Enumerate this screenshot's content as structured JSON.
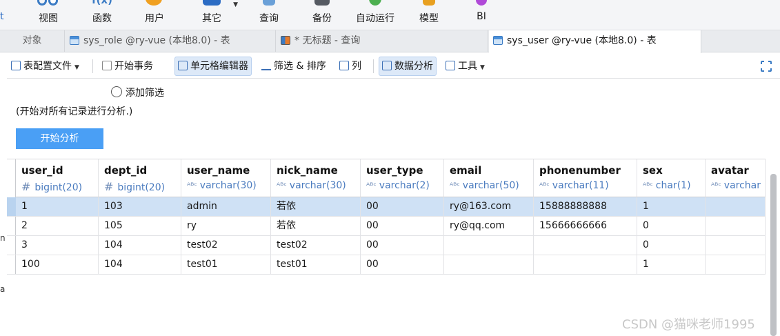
{
  "toolbar": {
    "items": [
      {
        "label": "视图",
        "color": "#3b7bc4"
      },
      {
        "label": "函数",
        "color": "#3b7bc4"
      },
      {
        "label": "用户",
        "color": "#f0a020"
      },
      {
        "label": "其它",
        "color": "#2b6cc4"
      },
      {
        "label": "查询",
        "color": "#6aa0d8"
      },
      {
        "label": "备份",
        "color": "#555a62"
      },
      {
        "label": "自动运行",
        "color": "#4caf50"
      },
      {
        "label": "模型",
        "color": "#e8a020"
      },
      {
        "label": "BI",
        "color": "#b049d8"
      }
    ],
    "clipped_left_char": "t",
    "fx_glyph": "f(x)"
  },
  "tabs": {
    "objects": "对象",
    "tab1": "sys_role @ry-vue (本地8.0) - 表",
    "tab2": "* 无标题 - 查询",
    "tab3": "sys_user @ry-vue (本地8.0) - 表"
  },
  "subtoolbar": {
    "table_config": "表配置文件",
    "begin_tx": "开始事务",
    "cell_editor": "单元格编辑器",
    "filter_sort": "筛选 & 排序",
    "columns": "列",
    "data_analysis": "数据分析",
    "tools": "工具"
  },
  "analysis": {
    "add_filter": "添加筛选",
    "hint": "(开始对所有记录进行分析.)",
    "start_button": "开始分析"
  },
  "grid": {
    "columns": [
      {
        "name": "user_id",
        "type": "bigint(20)",
        "kind": "num"
      },
      {
        "name": "dept_id",
        "type": "bigint(20)",
        "kind": "num"
      },
      {
        "name": "user_name",
        "type": "varchar(30)",
        "kind": "text"
      },
      {
        "name": "nick_name",
        "type": "varchar(30)",
        "kind": "text"
      },
      {
        "name": "user_type",
        "type": "varchar(2)",
        "kind": "text"
      },
      {
        "name": "email",
        "type": "varchar(50)",
        "kind": "text"
      },
      {
        "name": "phonenumber",
        "type": "varchar(11)",
        "kind": "text"
      },
      {
        "name": "sex",
        "type": "char(1)",
        "kind": "text"
      },
      {
        "name": "avatar",
        "type": "varchar",
        "kind": "text"
      }
    ],
    "rows": [
      [
        "1",
        "103",
        "admin",
        "若依",
        "00",
        "ry@163.com",
        "15888888888",
        "1",
        ""
      ],
      [
        "2",
        "105",
        "ry",
        "若依",
        "00",
        "ry@qq.com",
        "15666666666",
        "0",
        ""
      ],
      [
        "3",
        "104",
        "test02",
        "test02",
        "00",
        "",
        "",
        "0",
        ""
      ],
      [
        "100",
        "104",
        "test01",
        "test01",
        "00",
        "",
        "",
        "1",
        ""
      ]
    ],
    "selected_row": 0
  },
  "side_marks": [
    "n",
    "a"
  ],
  "watermark": "CSDN @猫咪老师1995"
}
